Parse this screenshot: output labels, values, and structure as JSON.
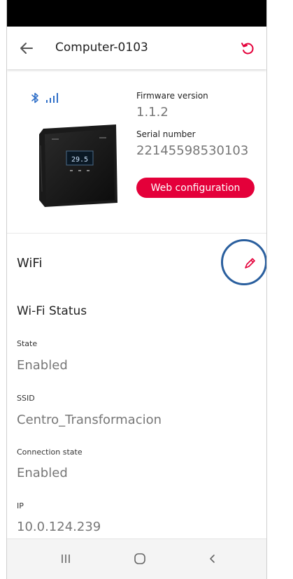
{
  "header": {
    "title": "Computer-0103",
    "back_icon": "arrow-left-icon",
    "refresh_icon": "refresh-icon",
    "accent_color": "#e4003a"
  },
  "device": {
    "bluetooth_icon": "bluetooth-icon",
    "signal_icon": "signal-bars-icon",
    "image": "thermostat-device-image",
    "screen_text": "29.5",
    "firmware_label": "Firmware version",
    "firmware_value": "1.1.2",
    "serial_label": "Serial number",
    "serial_value": "22145598530103",
    "web_config_label": "Web configuration"
  },
  "wifi": {
    "title": "WiFi",
    "edit_icon": "pencil-icon",
    "highlight_color": "#2a5f9e",
    "status_title": "Wi-Fi Status",
    "fields": [
      {
        "label": "State",
        "value": "Enabled"
      },
      {
        "label": "SSID",
        "value": "Centro_Transformacion"
      },
      {
        "label": "Connection state",
        "value": "Enabled"
      },
      {
        "label": "IP",
        "value": "10.0.124.239"
      }
    ]
  },
  "navbar": {
    "recents_icon": "recents-icon",
    "home_icon": "home-icon",
    "back_icon": "nav-back-icon"
  }
}
